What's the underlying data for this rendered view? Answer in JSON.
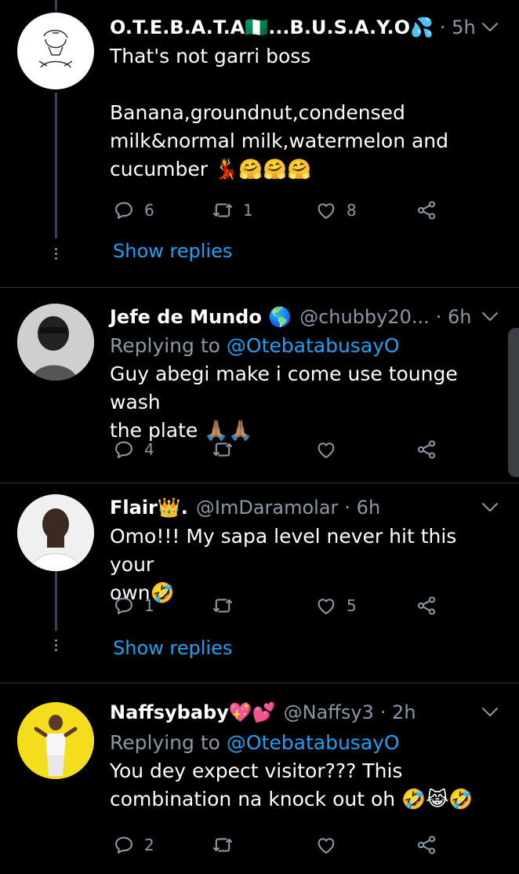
{
  "tweets": [
    {
      "name": "O.T.E.B.A.T.A🇳🇬...B.U.S.A.Y.O💦",
      "handle": "",
      "time": "· 5h",
      "replying_to": "",
      "text_lines": [
        "That's not garri boss",
        "",
        "Banana,groundnut,condensed",
        "milk&normal milk,watermelon and",
        "cucumber 💃🤗🤗🤗"
      ],
      "replies": "6",
      "retweets": "1",
      "likes": "8",
      "show_replies": "Show replies"
    },
    {
      "name": "Jefe de Mundo 🌎",
      "handle": "@chubby20...",
      "time": "· 6h",
      "replying_label": "Replying to",
      "replying_to": "@OtebatabusayO",
      "text_lines": [
        "Guy abegi make i come use tounge wash",
        "the plate 🙏🏽🙏🏽"
      ],
      "replies": "4",
      "retweets": "",
      "likes": ""
    },
    {
      "name": "Flair👑.",
      "handle": "@ImDaramolar",
      "time": "· 6h",
      "text_lines": [
        "Omo!!! My sapa level never hit this your",
        "own🤣"
      ],
      "replies": "1",
      "retweets": "",
      "likes": "5",
      "show_replies": "Show replies"
    },
    {
      "name": "Naffsybaby💖💕",
      "handle": "@Naffsy3",
      "time": "· 2h",
      "replying_label": "Replying to",
      "replying_to": "@OtebatabusayO",
      "text_lines": [
        "You dey expect visitor??? This",
        "combination na knock out oh 🤣😹🤣"
      ],
      "replies": "2",
      "retweets": "",
      "likes": ""
    }
  ],
  "icons": [
    "reply-icon",
    "retweet-icon",
    "like-icon",
    "share-icon",
    "chevron-down-icon"
  ],
  "colors": {
    "background": "#000000",
    "secondary_text": "#8899a6",
    "link": "#1da1f2",
    "divider": "#2f3336"
  }
}
